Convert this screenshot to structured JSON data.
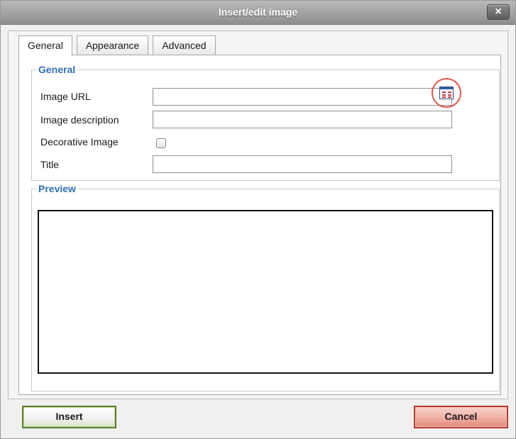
{
  "window": {
    "title": "Insert/edit image",
    "close_label": "×"
  },
  "tabs": [
    {
      "label": "General",
      "active": true
    },
    {
      "label": "Appearance",
      "active": false
    },
    {
      "label": "Advanced",
      "active": false
    }
  ],
  "general": {
    "legend": "General",
    "fields": {
      "image_url": {
        "label": "Image URL",
        "value": ""
      },
      "image_description": {
        "label": "Image description",
        "value": ""
      },
      "decorative_image": {
        "label": "Decorative Image",
        "checked": false
      },
      "title": {
        "label": "Title",
        "value": ""
      }
    },
    "browse_icon": "file-browser-icon"
  },
  "preview": {
    "legend": "Preview"
  },
  "buttons": {
    "insert": "Insert",
    "cancel": "Cancel"
  },
  "colors": {
    "legend_blue": "#2f6fb5",
    "highlight_ring": "#e0574a",
    "insert_border": "#5a7f2e",
    "cancel_border": "#b33a2d"
  }
}
